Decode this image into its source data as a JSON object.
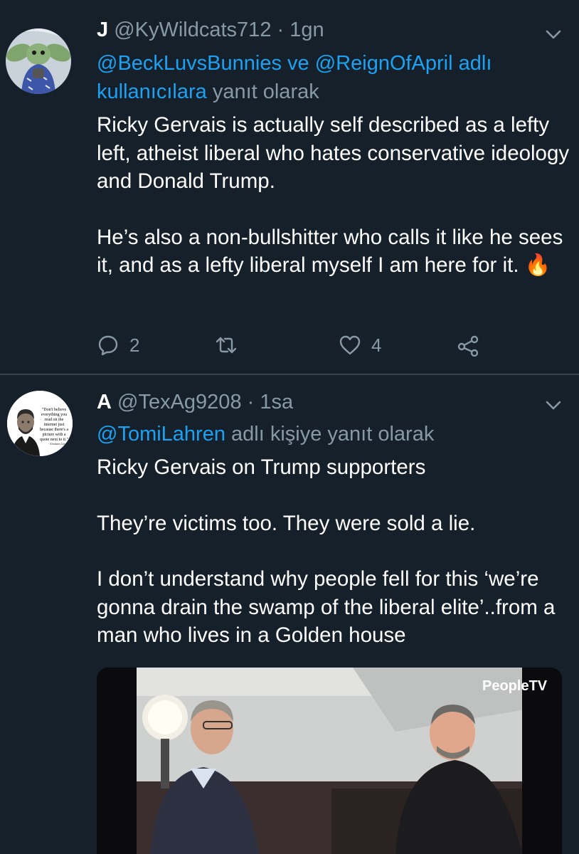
{
  "tweets": [
    {
      "name": "J",
      "handle": "@KyWildcats712",
      "separator": "·",
      "time": "1gn",
      "reply_mention_1": "@BeckLuvsBunnies",
      "reply_connector": "ve",
      "reply_mention_2": "@ReignOfApril",
      "reply_mention_suffix": "adlı kullanıcılara",
      "reply_tail": "yanıt olarak",
      "paragraphs": [
        "Ricky Gervais is actually self described as a lefty left, atheist liberal who hates conservative ideology and Donald Trump.",
        "He’s also a non-bullshitter who calls it like he sees it, and as a lefty liberal myself I am here for it. 🔥"
      ],
      "reply_count": "2",
      "like_count": "4"
    },
    {
      "name": "A",
      "handle": "@TexAg9208",
      "separator": "·",
      "time": "1sa",
      "reply_mention": "@TomiLahren",
      "reply_tail": "adlı kişiye yanıt olarak",
      "paragraphs": [
        "Ricky Gervais on Trump supporters",
        "They’re victims too. They were sold a lie.",
        "I don’t understand why people fell for this ‘we’re gonna drain the swamp of the liberal elite’..from a man who lives in a Golden house"
      ],
      "avatar_quote": "\"Don't believe everything you read on the internet just because there's a picture with a quote next to it.\"",
      "avatar_attribution": "- Abraham Lincoln",
      "media_watermark": "PeopleTV"
    }
  ],
  "colors": {
    "background": "#15202b",
    "divider": "#38444d",
    "secondary_text": "#8899a6",
    "link": "#1da1f2",
    "fire": "#ff6a00"
  },
  "icons": [
    "chevron-down-icon",
    "reply-icon",
    "retweet-icon",
    "like-icon",
    "share-icon"
  ]
}
